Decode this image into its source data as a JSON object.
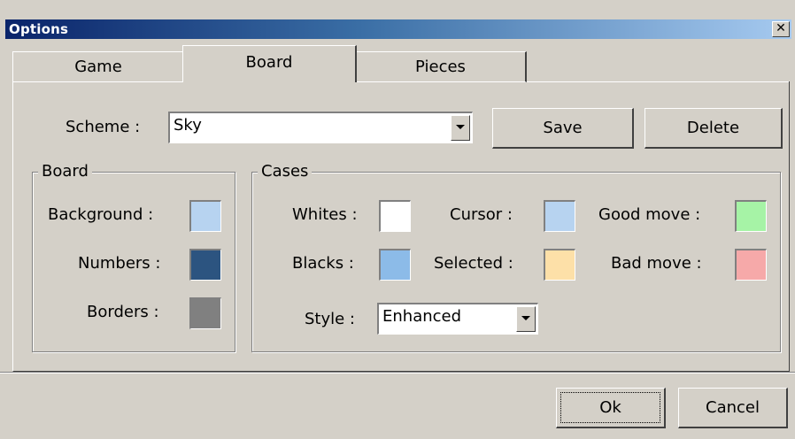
{
  "window": {
    "title": "Options",
    "close_glyph": "✕"
  },
  "tabs": [
    {
      "label": "Game",
      "selected": false
    },
    {
      "label": "Board",
      "selected": true
    },
    {
      "label": "Pieces",
      "selected": false
    }
  ],
  "scheme": {
    "label": "Scheme :",
    "value": "Sky",
    "save_label": "Save",
    "delete_label": "Delete"
  },
  "board_group": {
    "title": "Board",
    "items": [
      {
        "label": "Background :",
        "color": "#b7d3f0"
      },
      {
        "label": "Numbers :",
        "color": "#2c5480"
      },
      {
        "label": "Borders :",
        "color": "#808080"
      }
    ]
  },
  "cases_group": {
    "title": "Cases",
    "whites": {
      "label": "Whites :",
      "color": "#ffffff"
    },
    "blacks": {
      "label": "Blacks :",
      "color": "#8cbbe8"
    },
    "cursor": {
      "label": "Cursor :",
      "color": "#b7d3f0"
    },
    "selected": {
      "label": "Selected :",
      "color": "#fde0a8"
    },
    "good_move": {
      "label": "Good move :",
      "color": "#a6f3a6"
    },
    "bad_move": {
      "label": "Bad move :",
      "color": "#f6a9a9"
    },
    "style": {
      "label": "Style :",
      "value": "Enhanced"
    }
  },
  "footer": {
    "ok_label": "Ok",
    "cancel_label": "Cancel"
  },
  "colors": {
    "dialog_face": "#d4d0c8",
    "titlebar_start": "#0a246a",
    "titlebar_end": "#a6caf0"
  }
}
